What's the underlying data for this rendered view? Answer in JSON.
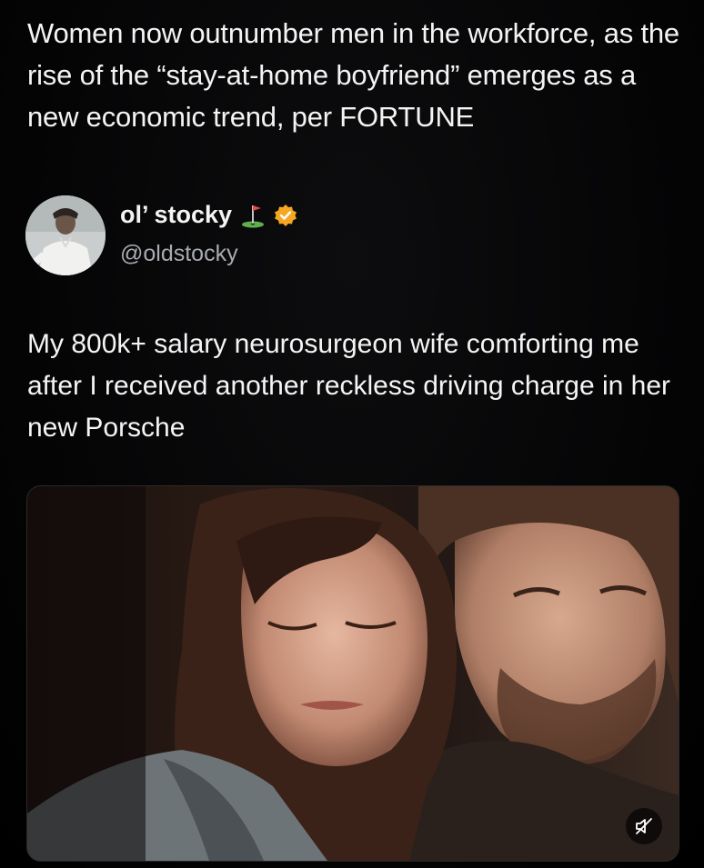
{
  "headline": {
    "text": "Women now outnumber men in the workforce, as the rise of the “stay-at-home boyfriend” emerges as a new economic trend, per FORTUNE"
  },
  "author": {
    "name": "ol’ stocky",
    "handle": "@oldstocky",
    "icons": [
      "golf-flag-icon",
      "verified-badge-icon"
    ],
    "verified_color": "#F5A623"
  },
  "post": {
    "text": "My 800k+ salary neurosurgeon wife comforting me after I received another reckless driving charge in her new Porsche"
  },
  "media": {
    "type": "video",
    "muted": true,
    "icon": "muted-speaker-icon"
  },
  "colors": {
    "background": "#000000",
    "text_primary": "#F4F4F4",
    "text_secondary": "#A8ACB0"
  }
}
